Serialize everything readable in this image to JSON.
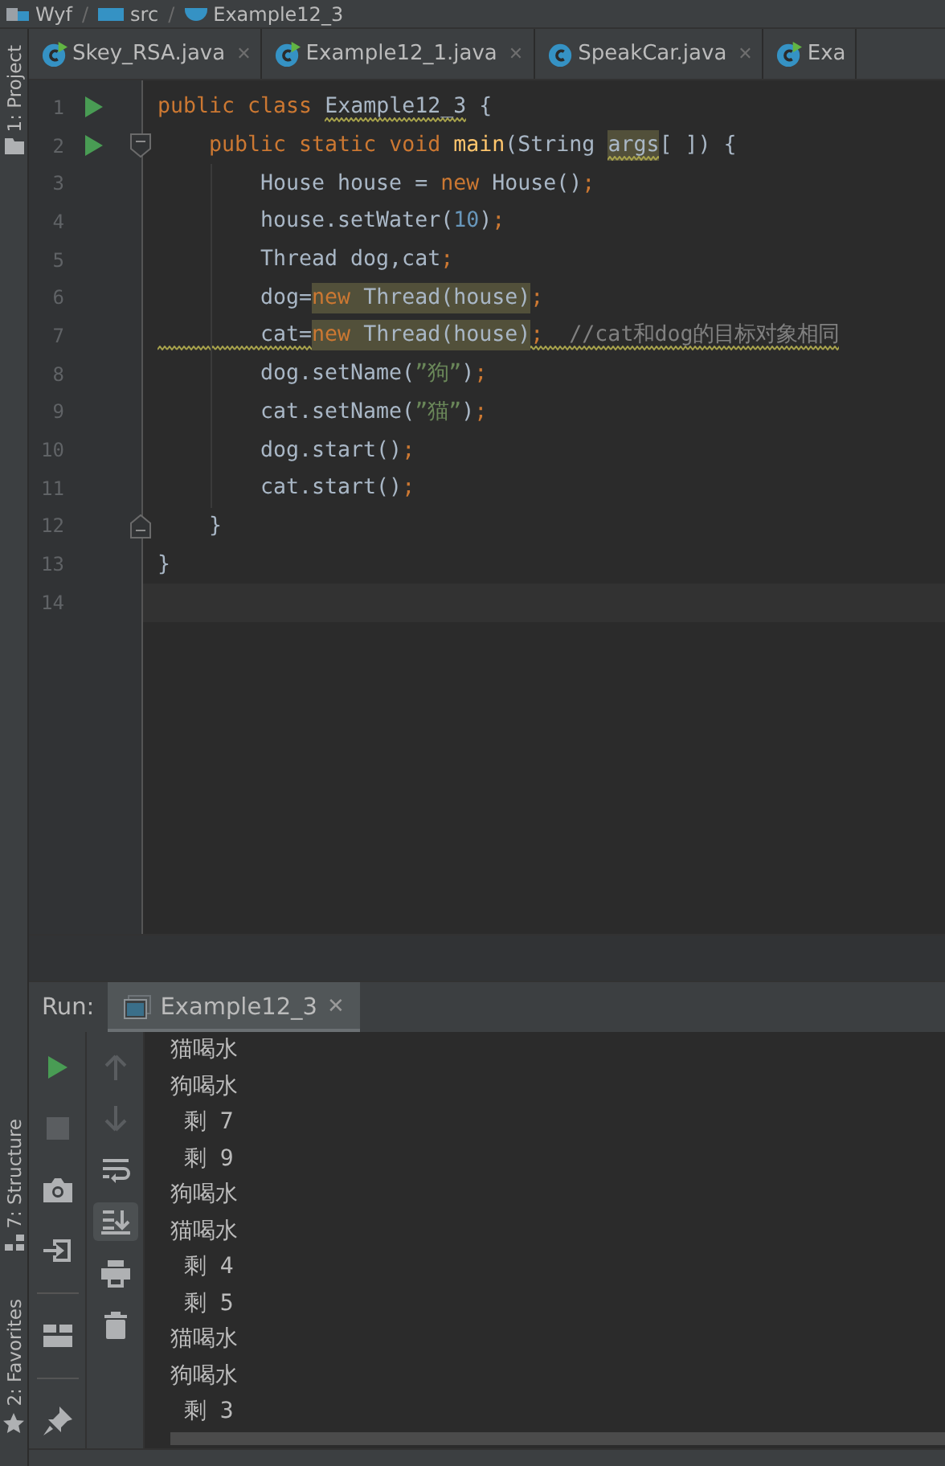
{
  "breadcrumb": [
    {
      "label": "Wyf",
      "kind": "module"
    },
    {
      "label": "src",
      "kind": "folder",
      "sep": "/"
    },
    {
      "label": "Example12_3",
      "kind": "class",
      "sep": "/"
    }
  ],
  "side_tools": [
    {
      "label": "1: Project",
      "kind": "folder"
    },
    {
      "label": "7: Structure",
      "kind": "structure"
    },
    {
      "label": "2: Favorites",
      "kind": "star"
    }
  ],
  "tabs": [
    {
      "label": "Skey_RSA.java",
      "runnable": true,
      "close": "✕"
    },
    {
      "label": "Example12_1.java",
      "runnable": true,
      "close": "✕"
    },
    {
      "label": "SpeakCar.java",
      "runnable": false,
      "close": "✕"
    },
    {
      "label": "Exa",
      "runnable": true
    }
  ],
  "editor": {
    "lines": [
      {
        "number": "1",
        "run": true,
        "fold_open": false,
        "fold_close": false,
        "warning": false,
        "current": false,
        "tokens": [
          {
            "t": "public class ",
            "kind": "keyword",
            "highlight": false,
            "warning": false
          },
          {
            "t": "Example12_3",
            "kind": "plain",
            "highlight": false,
            "warning": true
          },
          {
            "t": " {",
            "kind": "plain",
            "highlight": false,
            "warning": false
          }
        ],
        "children": [
          {
            "number": "2",
            "run": true,
            "fold_open": true,
            "fold_close": false,
            "warning": false,
            "current": false,
            "tokens": [
              {
                "t": "public static void ",
                "kind": "keyword",
                "highlight": false,
                "warning": false
              },
              {
                "t": "main",
                "kind": "method",
                "highlight": false,
                "warning": false
              },
              {
                "t": "(String ",
                "kind": "plain",
                "highlight": false,
                "warning": false
              },
              {
                "t": "args",
                "kind": "plain",
                "highlight": true,
                "warning": true
              },
              {
                "t": "[ ]) {",
                "kind": "plain",
                "highlight": false,
                "warning": false
              }
            ],
            "children": [
              {
                "number": "3",
                "run": false,
                "fold_open": false,
                "fold_close": false,
                "warning": false,
                "current": false,
                "tokens": [
                  {
                    "t": "House house = ",
                    "kind": "plain",
                    "highlight": false,
                    "warning": false
                  },
                  {
                    "t": "new",
                    "kind": "keyword",
                    "highlight": false,
                    "warning": false
                  },
                  {
                    "t": " House()",
                    "kind": "plain",
                    "highlight": false,
                    "warning": false
                  },
                  {
                    "t": ";",
                    "kind": "keyword",
                    "highlight": false,
                    "warning": false
                  }
                ]
              },
              {
                "number": "4",
                "run": false,
                "fold_open": false,
                "fold_close": false,
                "warning": false,
                "current": false,
                "tokens": [
                  {
                    "t": "house.setWater(",
                    "kind": "plain",
                    "highlight": false,
                    "warning": false
                  },
                  {
                    "t": "10",
                    "kind": "number",
                    "highlight": false,
                    "warning": false
                  },
                  {
                    "t": ")",
                    "kind": "plain",
                    "highlight": false,
                    "warning": false
                  },
                  {
                    "t": ";",
                    "kind": "keyword",
                    "highlight": false,
                    "warning": false
                  }
                ]
              },
              {
                "number": "5",
                "run": false,
                "fold_open": false,
                "fold_close": false,
                "warning": false,
                "current": false,
                "tokens": [
                  {
                    "t": "Thread dog,cat",
                    "kind": "plain",
                    "highlight": false,
                    "warning": false
                  },
                  {
                    "t": ";",
                    "kind": "keyword",
                    "highlight": false,
                    "warning": false
                  }
                ]
              },
              {
                "number": "6",
                "run": false,
                "fold_open": false,
                "fold_close": false,
                "warning": false,
                "current": false,
                "tokens": [
                  {
                    "t": "dog=",
                    "kind": "plain",
                    "highlight": false,
                    "warning": false
                  },
                  {
                    "t": "new",
                    "kind": "keyword",
                    "highlight": true,
                    "warning": false
                  },
                  {
                    "t": " Thread(house)",
                    "kind": "plain",
                    "highlight": true,
                    "warning": false
                  },
                  {
                    "t": ";",
                    "kind": "keyword",
                    "highlight": false,
                    "warning": false
                  }
                ]
              },
              {
                "number": "7",
                "run": false,
                "fold_open": false,
                "fold_close": false,
                "warning": true,
                "current": false,
                "tokens": [
                  {
                    "t": "cat=",
                    "kind": "plain",
                    "highlight": false,
                    "warning": false
                  },
                  {
                    "t": "new",
                    "kind": "keyword",
                    "highlight": true,
                    "warning": false
                  },
                  {
                    "t": " Thread(house)",
                    "kind": "plain",
                    "highlight": true,
                    "warning": false
                  },
                  {
                    "t": ";",
                    "kind": "keyword",
                    "highlight": false,
                    "warning": false
                  },
                  {
                    "t": "  //cat和dog的目标对象相同",
                    "kind": "comment",
                    "highlight": false,
                    "warning": false
                  }
                ]
              },
              {
                "number": "8",
                "run": false,
                "fold_open": false,
                "fold_close": false,
                "warning": false,
                "current": false,
                "tokens": [
                  {
                    "t": "dog.setName(",
                    "kind": "plain",
                    "highlight": false,
                    "warning": false
                  },
                  {
                    "t": "”狗”",
                    "kind": "string",
                    "highlight": false,
                    "warning": false
                  },
                  {
                    "t": ")",
                    "kind": "plain",
                    "highlight": false,
                    "warning": false
                  },
                  {
                    "t": ";",
                    "kind": "keyword",
                    "highlight": false,
                    "warning": false
                  }
                ]
              },
              {
                "number": "9",
                "run": false,
                "fold_open": false,
                "fold_close": false,
                "warning": false,
                "current": false,
                "tokens": [
                  {
                    "t": "cat.setName(",
                    "kind": "plain",
                    "highlight": false,
                    "warning": false
                  },
                  {
                    "t": "”猫”",
                    "kind": "string",
                    "highlight": false,
                    "warning": false
                  },
                  {
                    "t": ")",
                    "kind": "plain",
                    "highlight": false,
                    "warning": false
                  },
                  {
                    "t": ";",
                    "kind": "keyword",
                    "highlight": false,
                    "warning": false
                  }
                ]
              },
              {
                "number": "10",
                "run": false,
                "fold_open": false,
                "fold_close": false,
                "warning": false,
                "current": false,
                "tokens": [
                  {
                    "t": "dog.start()",
                    "kind": "plain",
                    "highlight": false,
                    "warning": false
                  },
                  {
                    "t": ";",
                    "kind": "keyword",
                    "highlight": false,
                    "warning": false
                  }
                ]
              },
              {
                "number": "11",
                "run": false,
                "fold_open": false,
                "fold_close": false,
                "warning": false,
                "current": false,
                "tokens": [
                  {
                    "t": "cat.start()",
                    "kind": "plain",
                    "highlight": false,
                    "warning": false
                  },
                  {
                    "t": ";",
                    "kind": "keyword",
                    "highlight": false,
                    "warning": false
                  }
                ]
              }
            ]
          },
          {
            "number": "12",
            "run": false,
            "fold_open": false,
            "fold_close": true,
            "warning": false,
            "current": false,
            "tokens": [
              {
                "t": "}",
                "kind": "plain",
                "highlight": false,
                "warning": false
              }
            ]
          }
        ]
      },
      {
        "number": "13",
        "run": false,
        "fold_open": false,
        "fold_close": false,
        "warning": false,
        "current": false,
        "tokens": [
          {
            "t": "}",
            "kind": "plain",
            "highlight": false,
            "warning": false
          }
        ]
      },
      {
        "number": "14",
        "run": false,
        "fold_open": false,
        "fold_close": false,
        "warning": false,
        "current": true
      }
    ]
  },
  "run_panel": {
    "label": "Run:",
    "tab": {
      "label": "Example12_3",
      "selected": true,
      "close": "✕"
    },
    "tools_left": [
      {
        "kind": "run",
        "disabled": false
      },
      {
        "kind": "stop",
        "disabled": true
      },
      {
        "kind": "camera",
        "disabled": false
      },
      {
        "kind": "login",
        "disabled": false
      },
      {
        "kind": "layout",
        "disabled": false
      },
      {
        "kind": "pin",
        "disabled": false
      }
    ],
    "tools_right": [
      {
        "kind": "up",
        "disabled": true,
        "selected": false
      },
      {
        "kind": "down",
        "disabled": true,
        "selected": false
      },
      {
        "kind": "wrap",
        "disabled": false,
        "selected": false
      },
      {
        "kind": "scroll-end",
        "disabled": false,
        "selected": true
      },
      {
        "kind": "print",
        "disabled": false,
        "selected": false
      },
      {
        "kind": "trash",
        "disabled": false,
        "selected": false
      }
    ],
    "output": [
      "猫喝水",
      "狗喝水",
      " 剩 7",
      " 剩 9",
      "狗喝水",
      "猫喝水",
      " 剩 4",
      " 剩 5",
      "猫喝水",
      "狗喝水",
      " 剩 3"
    ]
  }
}
